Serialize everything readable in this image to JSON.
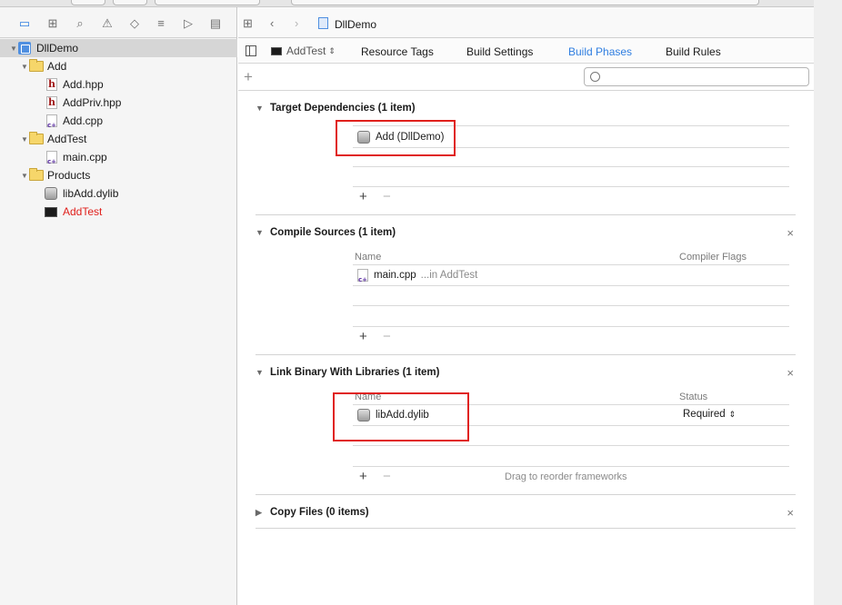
{
  "navigator": {
    "items": [
      {
        "label": "DllDemo"
      },
      {
        "label": "Add"
      },
      {
        "label": "Add.hpp"
      },
      {
        "label": "AddPriv.hpp"
      },
      {
        "label": "Add.cpp"
      },
      {
        "label": "AddTest"
      },
      {
        "label": "main.cpp"
      },
      {
        "label": "Products"
      },
      {
        "label": "libAdd.dylib"
      },
      {
        "label": "AddTest"
      }
    ]
  },
  "jump_bar": {
    "title": "DllDemo"
  },
  "tabs": {
    "target": "AddTest",
    "items": [
      "Resource Tags",
      "Build Settings",
      "Build Phases",
      "Build Rules"
    ]
  },
  "filter": {
    "value": ""
  },
  "phases": {
    "target_deps": {
      "title": "Target Dependencies (1 item)",
      "row": "Add (DllDemo)"
    },
    "compile_sources": {
      "title": "Compile Sources (1 item)",
      "col_name": "Name",
      "col_flags": "Compiler Flags",
      "row_file": "main.cpp",
      "row_sub": "...in AddTest"
    },
    "link_binary": {
      "title": "Link Binary With Libraries (1 item)",
      "col_name": "Name",
      "col_status": "Status",
      "row_file": "libAdd.dylib",
      "row_status": "Required",
      "hint": "Drag to reorder frameworks"
    },
    "copy_files": {
      "title": "Copy Files (0 items)"
    }
  },
  "colors": {
    "accent": "#2f7ee0",
    "highlight": "#e0201c",
    "selected_row": "#d6d6d6"
  }
}
